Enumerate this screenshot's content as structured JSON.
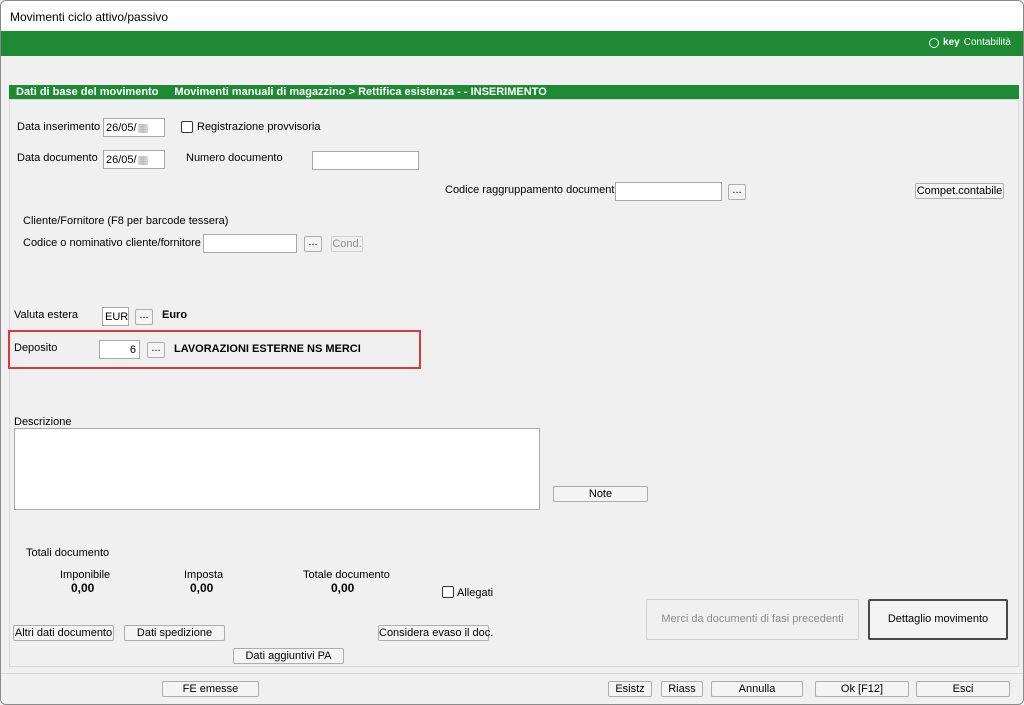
{
  "window": {
    "title": "Movimenti ciclo attivo/passivo",
    "brand_key": "key",
    "brand_name": "Contabilità",
    "accent_color": "#1e8a34"
  },
  "section": {
    "left": "Dati di base del  movimento",
    "right": "Movimenti manuali di magazzino > Rettifica esistenza - - INSERIMENTO"
  },
  "form": {
    "data_inserimento_label": "Data inserimento",
    "data_inserimento_value": "26/05/",
    "registrazione_provvisoria_label": "Registrazione provvisoria",
    "data_documento_label": "Data documento",
    "data_documento_value": "26/05/",
    "numero_documento_label": "Numero documento",
    "numero_documento_value": "",
    "codice_raggruppamento_label": "Codice raggruppamento documenti",
    "codice_raggruppamento_value": "",
    "compet_contabile_label": "Compet.contabile",
    "cliente_fornitore_label": "Cliente/Fornitore (F8 per barcode tessera)",
    "codice_cliente_label": "Codice o nominativo cliente/fornitore",
    "codice_cliente_value": "",
    "cond_label": "Cond.",
    "dots_label": "...",
    "valuta_label": "Valuta estera",
    "valuta_value": "EUR",
    "valuta_desc": "Euro",
    "deposito_label": "Deposito",
    "deposito_value": "6",
    "deposito_desc": "LAVORAZIONI ESTERNE NS MERCI",
    "descrizione_label": "Descrizione",
    "descrizione_value": "",
    "note_label": "Note"
  },
  "totals": {
    "title": "Totali documento",
    "imponibile_label": "Imponibile",
    "imponibile_value": "0,00",
    "imposta_label": "Imposta",
    "imposta_value": "0,00",
    "totale_label": "Totale documento",
    "totale_value": "0,00",
    "allegati_label": "Allegati"
  },
  "actions": {
    "altri_dati": "Altri dati documento",
    "dati_spedizione": "Dati spedizione",
    "considera_evaso": "Considera evaso il doc.",
    "dati_aggiuntivi_pa": "Dati aggiuntivi PA",
    "merci_da_documenti": "Merci da documenti di fasi precedenti",
    "dettaglio_movimento": "Dettaglio movimento"
  },
  "footer": {
    "fe_emesse": "FE emesse",
    "esistz": "Esistz",
    "riass": "Riass",
    "annulla": "Annulla",
    "ok": "Ok [F12]",
    "esci": "Esci"
  }
}
